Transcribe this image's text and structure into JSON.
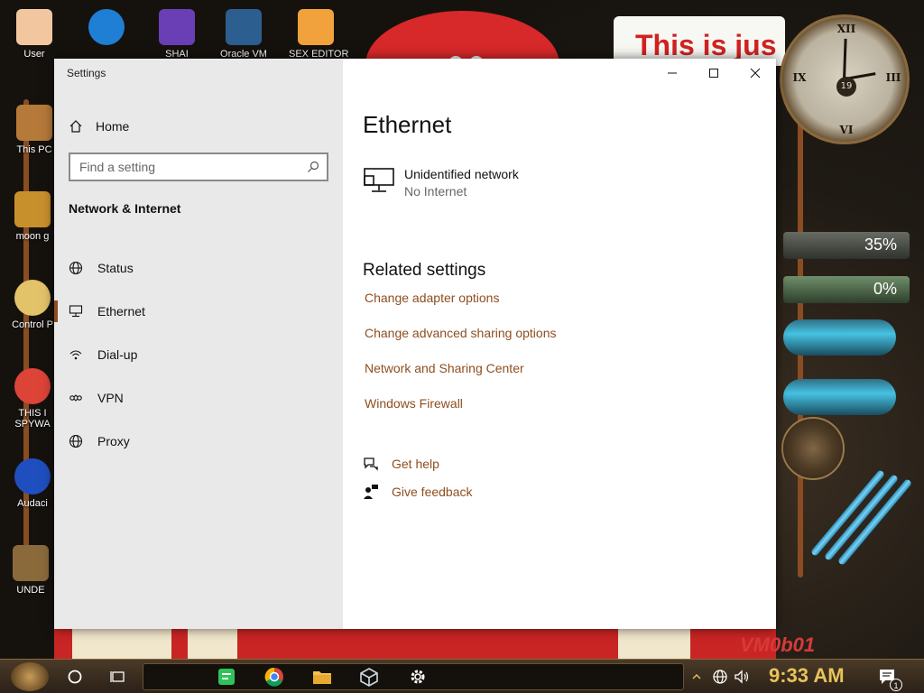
{
  "desktop": {
    "banner_text": "This is jus",
    "wallpaper_label": "VM0b01",
    "clock_numerals": [
      "XII",
      "III",
      "VI",
      "IX"
    ],
    "clock_date": "19",
    "gauges": [
      {
        "label": "35%",
        "value": 35
      },
      {
        "label": "0%",
        "value": 0
      }
    ],
    "icons": [
      {
        "label": "User",
        "color": "#f2c7a0"
      },
      {
        "label": "",
        "color": "#1f7fd4"
      },
      {
        "label": "SHAI",
        "color": "#6a3fb5"
      },
      {
        "label": "Oracle VM",
        "color": "#2c5f8f"
      },
      {
        "label": "SEX EDITOR",
        "color": "#f2a23c"
      },
      {
        "label": "This PC",
        "color": "#b57a3a"
      },
      {
        "label": "moon g",
        "color": "#c8902c"
      },
      {
        "label": "Control P",
        "color": "#e3c36a"
      },
      {
        "label": "THIS I SPYWA",
        "color": "#db4437"
      },
      {
        "label": "Audaci",
        "color": "#1f4fbf"
      },
      {
        "label": "UNDE",
        "color": "#8a6a3b"
      }
    ]
  },
  "window": {
    "app_title": "Settings",
    "home_label": "Home",
    "search_placeholder": "Find a setting",
    "section_title": "Network & Internet",
    "nav": [
      {
        "label": "Status",
        "icon": "globe-icon",
        "active": false
      },
      {
        "label": "Ethernet",
        "icon": "ethernet-icon",
        "active": true
      },
      {
        "label": "Dial-up",
        "icon": "dialup-icon",
        "active": false
      },
      {
        "label": "VPN",
        "icon": "vpn-icon",
        "active": false
      },
      {
        "label": "Proxy",
        "icon": "globe-icon",
        "active": false
      }
    ],
    "page_title": "Ethernet",
    "network": {
      "name": "Unidentified network",
      "status": "No Internet"
    },
    "related_title": "Related settings",
    "related_links": [
      "Change adapter options",
      "Change advanced sharing options",
      "Network and Sharing Center",
      "Windows Firewall"
    ],
    "help": {
      "get_help": "Get help",
      "give_feedback": "Give feedback"
    },
    "accent_color": "#8e4e1f"
  },
  "taskbar": {
    "time": "9:33 AM",
    "notification_count": "1",
    "apps": [
      "notes-icon",
      "chrome-icon",
      "folder-icon",
      "virtualbox-icon",
      "gear-icon"
    ]
  }
}
